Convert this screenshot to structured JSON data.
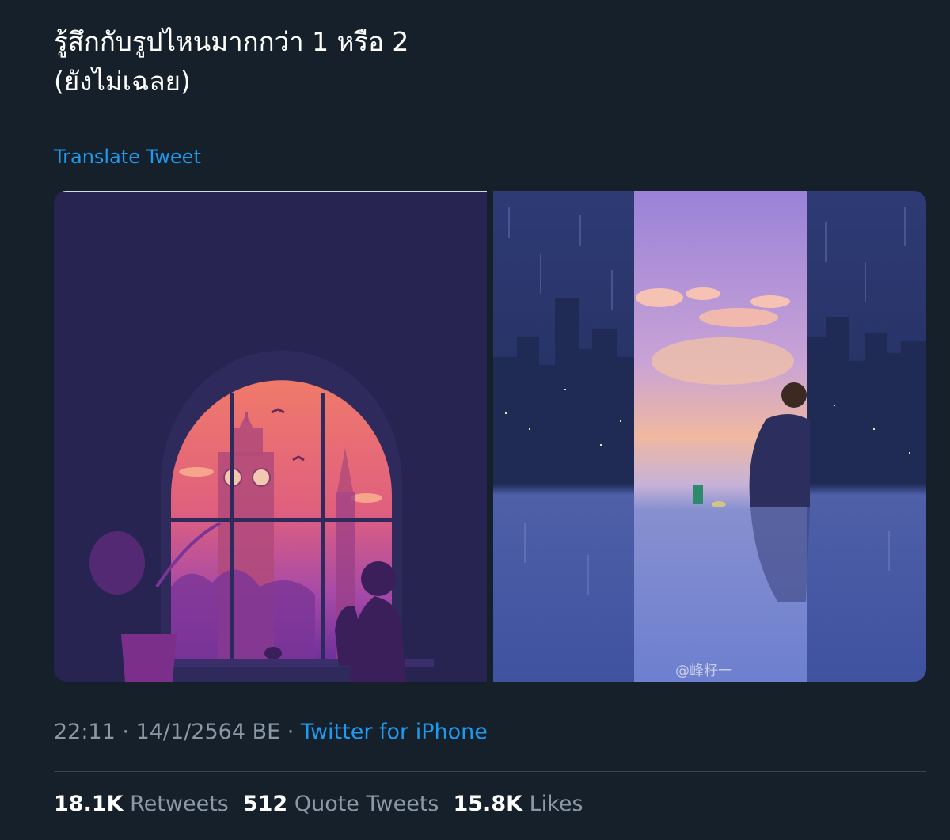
{
  "tweet": {
    "text_line1": "รู้สึกกับรูปไหนมากกว่า 1 หรือ 2",
    "text_line2": "(ยังไม่เฉลย)",
    "translate_label": "Translate Tweet"
  },
  "media": {
    "image1": {
      "name": "Window silhouette illustration"
    },
    "image2": {
      "name": "City rain illustration",
      "watermark": "@峰籽一"
    }
  },
  "meta": {
    "time": "22:11",
    "dot1": " · ",
    "date": "14/1/2564 BE",
    "dot2": " · ",
    "source": "Twitter for iPhone"
  },
  "stats": {
    "retweets_count": "18.1K",
    "retweets_label": "Retweets",
    "quotes_count": "512",
    "quotes_label": "Quote Tweets",
    "likes_count": "15.8K",
    "likes_label": "Likes"
  },
  "colors": {
    "background": "#15202b",
    "accent": "#1d9bf0",
    "secondary_text": "#8b98a5"
  }
}
